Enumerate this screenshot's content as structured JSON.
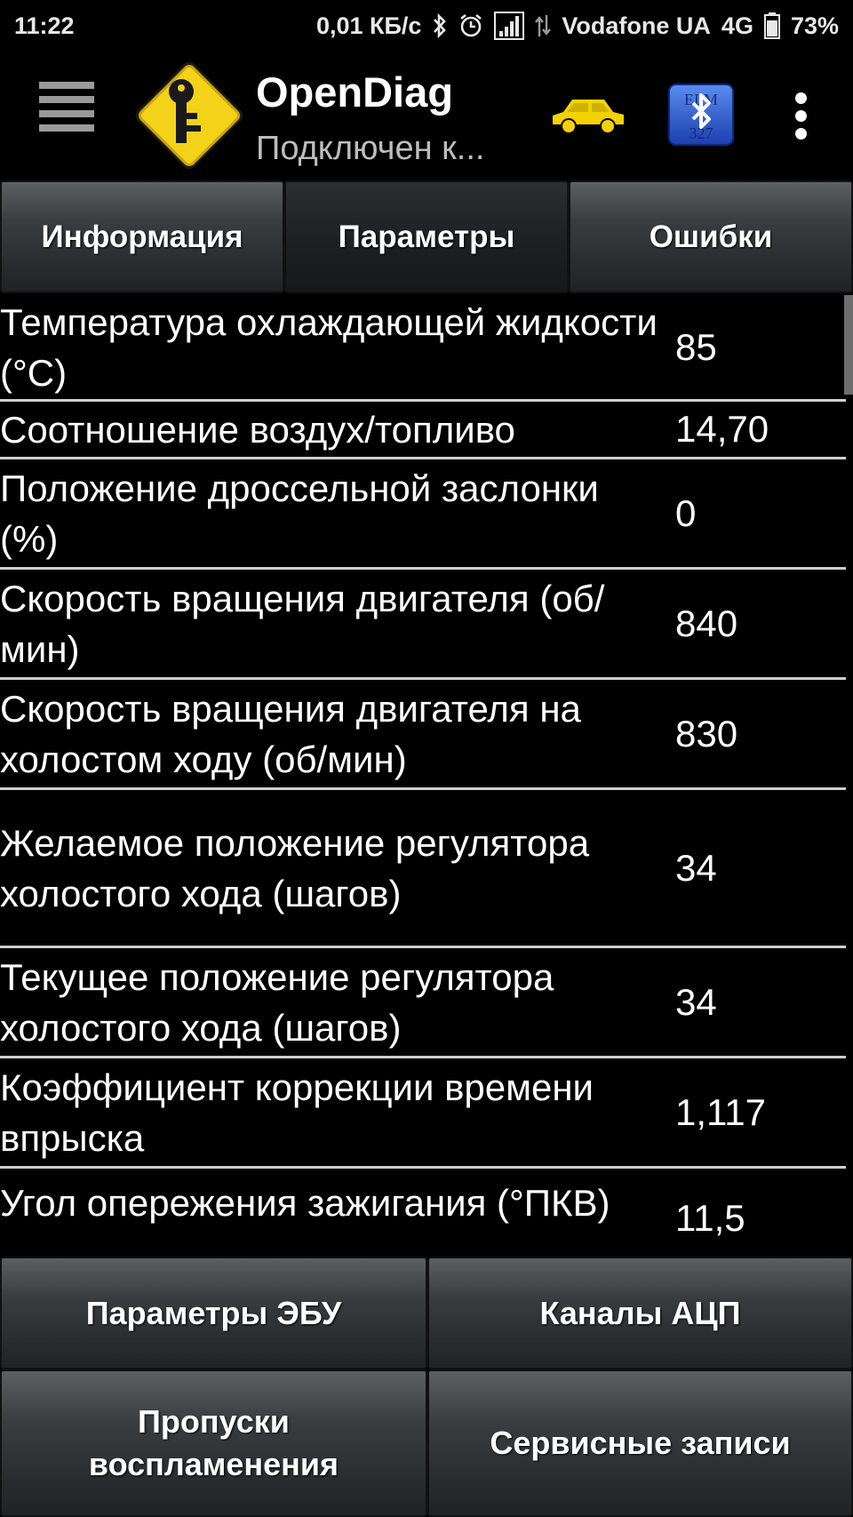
{
  "status_bar": {
    "time": "11:22",
    "speed": "0,01 КБ/с",
    "carrier": "Vodafone UA",
    "network": "4G",
    "battery": "73%",
    "icons": [
      "bluetooth-icon",
      "alarm-icon",
      "signal-icon",
      "data-arrows-icon",
      "battery-icon"
    ]
  },
  "app_bar": {
    "title": "OpenDiag",
    "subtitle": "Подключен к...",
    "icons": [
      "menu-icon",
      "app-logo",
      "car-icon",
      "bluetooth-elm327-icon",
      "overflow-menu-icon"
    ],
    "bt_badge_text": "ELM 327"
  },
  "tabs": [
    {
      "label": "Информация",
      "active": false
    },
    {
      "label": "Параметры",
      "active": true
    },
    {
      "label": "Ошибки",
      "active": false
    }
  ],
  "parameters": [
    {
      "label": "Температура охлаждающей жидкости (°C)",
      "value": "85"
    },
    {
      "label": "Соотношение воздух/топливо",
      "value": "14,70"
    },
    {
      "label": "Положение дроссельной заслонки (%)",
      "value": "0"
    },
    {
      "label": "Скорость вращения двигателя (об/мин)",
      "value": "840"
    },
    {
      "label": "Скорость вращения двигателя на холостом ходу (об/мин)",
      "value": "830"
    },
    {
      "label": "Желаемое положение регулятора холостого хода (шагов)",
      "value": "34"
    },
    {
      "label": "Текущее положение регулятора холостого хода (шагов)",
      "value": "34"
    },
    {
      "label": "Коэффициент коррекции времени впрыска",
      "value": "1,117"
    },
    {
      "label": "Угол опережения зажигания (°ПКВ)",
      "value": "11,5"
    }
  ],
  "bottom_buttons": {
    "ecu_params": "Параметры ЭБУ",
    "adc_channels": "Каналы АЦП",
    "misfires": "Пропуски воспламенения",
    "service_records": "Сервисные записи"
  },
  "colors": {
    "background": "#000000",
    "logo_yellow": "#f3d21a",
    "car_yellow": "#f2d200",
    "bt_blue": "#2a5bd6",
    "divider": "#cfcfcf"
  }
}
